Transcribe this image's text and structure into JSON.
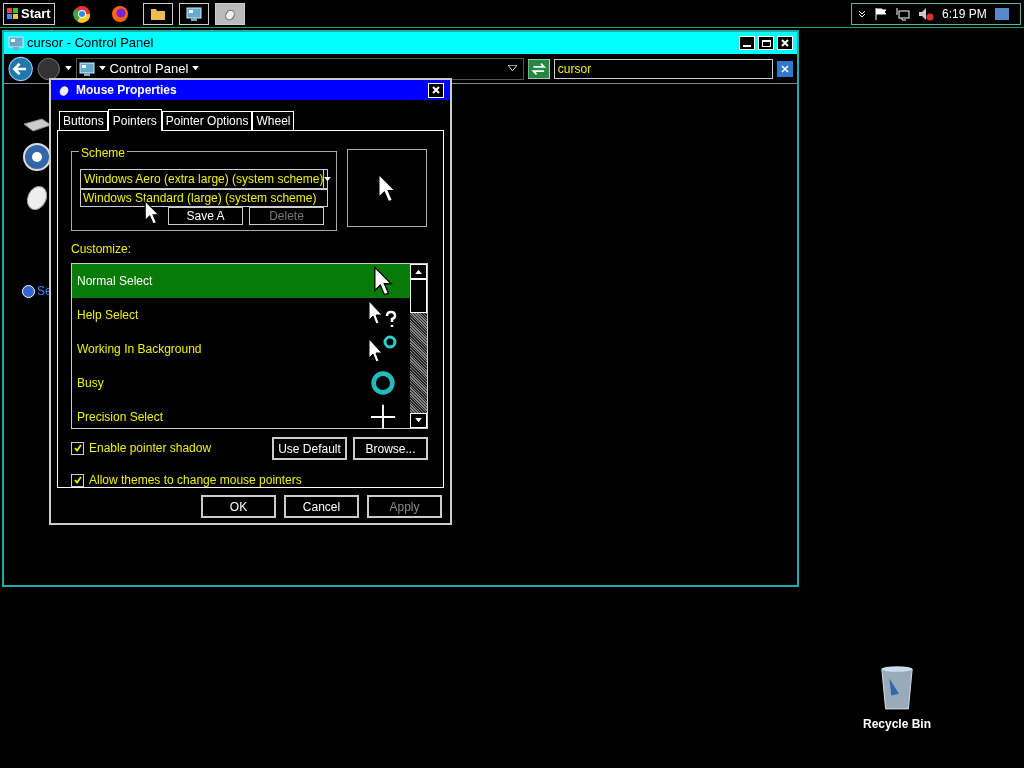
{
  "taskbar": {
    "start": "Start",
    "clock": "6:19 PM"
  },
  "explorer": {
    "title": "cursor - Control Panel",
    "breadcrumb": "Control Panel",
    "search": {
      "value": "cursor"
    },
    "help_link": "Se"
  },
  "dialog": {
    "title": "Mouse Properties",
    "tabs": [
      {
        "label": "Buttons",
        "selected": false
      },
      {
        "label": "Pointers",
        "selected": true
      },
      {
        "label": "Pointer Options",
        "selected": false
      },
      {
        "label": "Wheel",
        "selected": false
      }
    ],
    "scheme": {
      "label": "Scheme",
      "value": "Windows Aero (extra large) (system scheme)",
      "open_option": "Windows Standard (large) (system scheme)",
      "buttons": [
        {
          "label": "Save A",
          "disabled": false
        },
        {
          "label": "Delete",
          "disabled": true
        }
      ]
    },
    "customize_label": "Customize:",
    "pointers": [
      {
        "name": "Normal Select",
        "kind": "arrow",
        "selected": true
      },
      {
        "name": "Help Select",
        "kind": "help",
        "selected": false
      },
      {
        "name": "Working In Background",
        "kind": "working",
        "selected": false
      },
      {
        "name": "Busy",
        "kind": "busy",
        "selected": false
      },
      {
        "name": "Precision Select",
        "kind": "cross",
        "selected": false
      }
    ],
    "list_buttons": [
      "Use Default",
      "Browse..."
    ],
    "checkboxes": [
      {
        "label": "Enable pointer shadow",
        "checked": true
      },
      {
        "label": "Allow themes to change mouse pointers",
        "checked": true
      }
    ],
    "buttons": [
      {
        "label": "OK",
        "disabled": false
      },
      {
        "label": "Cancel",
        "disabled": false
      },
      {
        "label": "Apply",
        "disabled": true
      }
    ]
  },
  "desktop": {
    "recycle_bin": "Recycle Bin"
  }
}
